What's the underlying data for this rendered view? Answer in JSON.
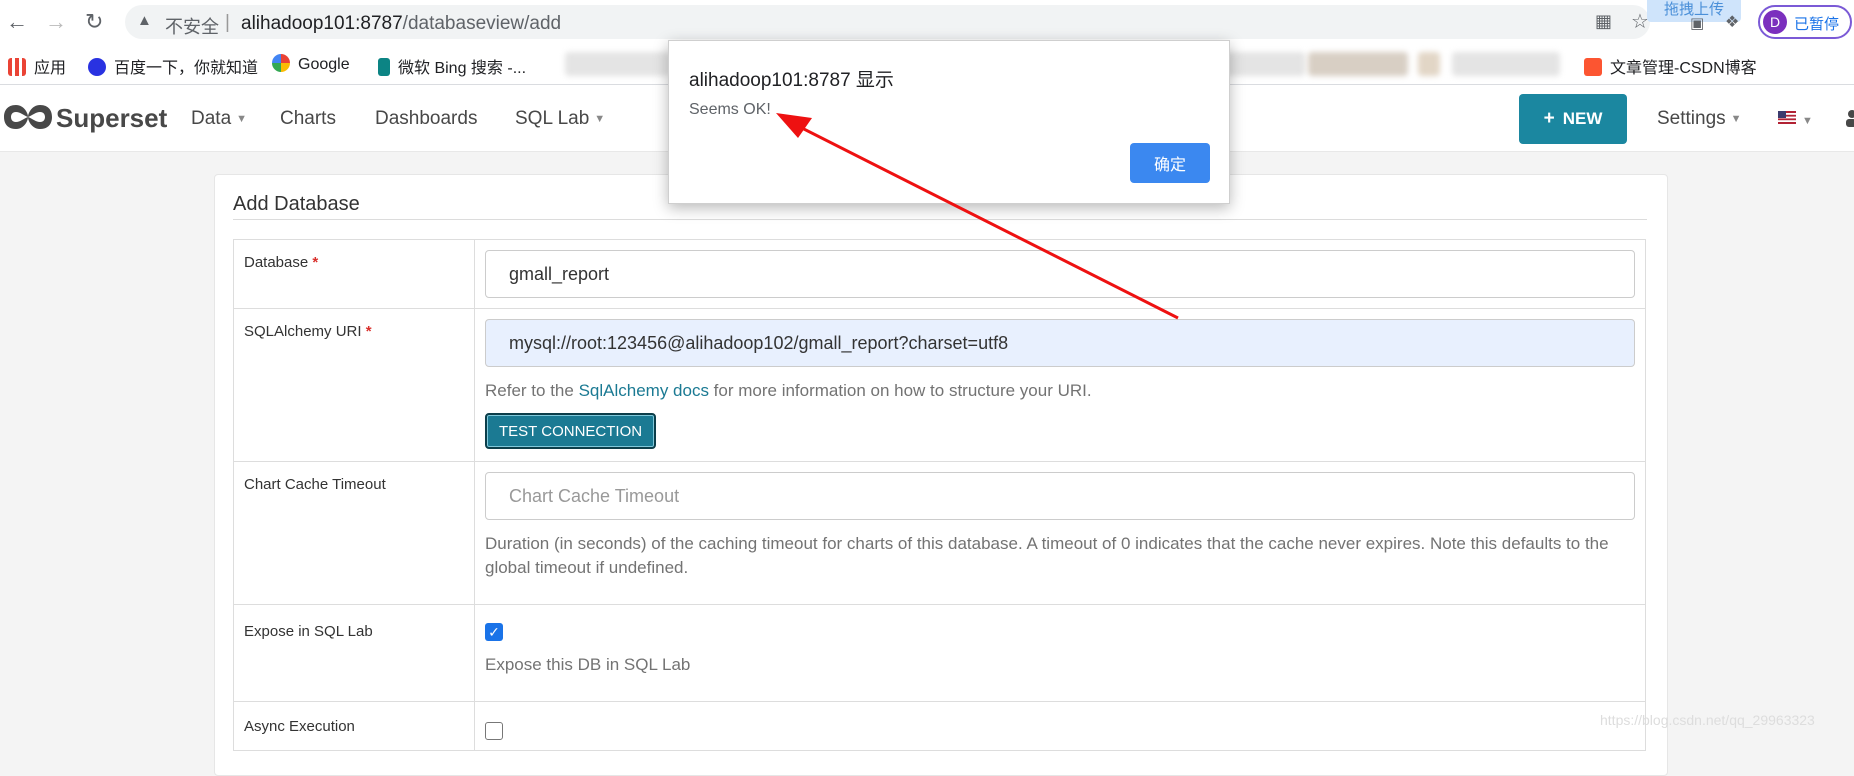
{
  "browser": {
    "url_warning": "不安全",
    "url_host": "alihadoop101:8787",
    "url_path": "/databaseview/add",
    "upload_chip": "拖拽上传",
    "profile_initial": "D",
    "profile_label": "已暂停",
    "bookmarks": [
      {
        "label": "应用",
        "color": "#d93025"
      },
      {
        "label": "百度一下，你就知道",
        "color": "#2932e1"
      },
      {
        "label": "Google",
        "color": "#4285f4"
      },
      {
        "label": "微软 Bing 搜索 -...",
        "color": "#0c8484"
      },
      {
        "label": "文章管理-CSDN博客",
        "color": "#fc5531"
      }
    ]
  },
  "navbar": {
    "logo": "Superset",
    "items": [
      {
        "label": "Data",
        "caret": true
      },
      {
        "label": "Charts",
        "caret": false
      },
      {
        "label": "Dashboards",
        "caret": false
      },
      {
        "label": "SQL Lab",
        "caret": true
      }
    ],
    "new_label": "NEW",
    "settings_label": "Settings"
  },
  "form": {
    "title": "Add Database",
    "database": {
      "label": "Database",
      "value": "gmall_report"
    },
    "uri": {
      "label": "SQLAlchemy URI",
      "value": "mysql://root:123456@alihadoop102/gmall_report?charset=utf8",
      "help_before": "Refer to the ",
      "help_link": "SqlAlchemy docs",
      "help_after": " for more information on how to structure your URI.",
      "test_label": "TEST CONNECTION"
    },
    "cache": {
      "label": "Chart Cache Timeout",
      "placeholder": "Chart Cache Timeout",
      "help": "Duration (in seconds) of the caching timeout for charts of this database. A timeout of 0 indicates that the cache never expires. Note this defaults to the global timeout if undefined."
    },
    "expose": {
      "label": "Expose in SQL Lab",
      "checked": true,
      "help": "Expose this DB in SQL Lab"
    },
    "async": {
      "label": "Async Execution",
      "checked": false
    }
  },
  "dialog": {
    "title": "alihadoop101:8787 显示",
    "message": "Seems OK!",
    "ok_label": "确定"
  },
  "watermark": "https://blog.csdn.net/qq_29963323"
}
